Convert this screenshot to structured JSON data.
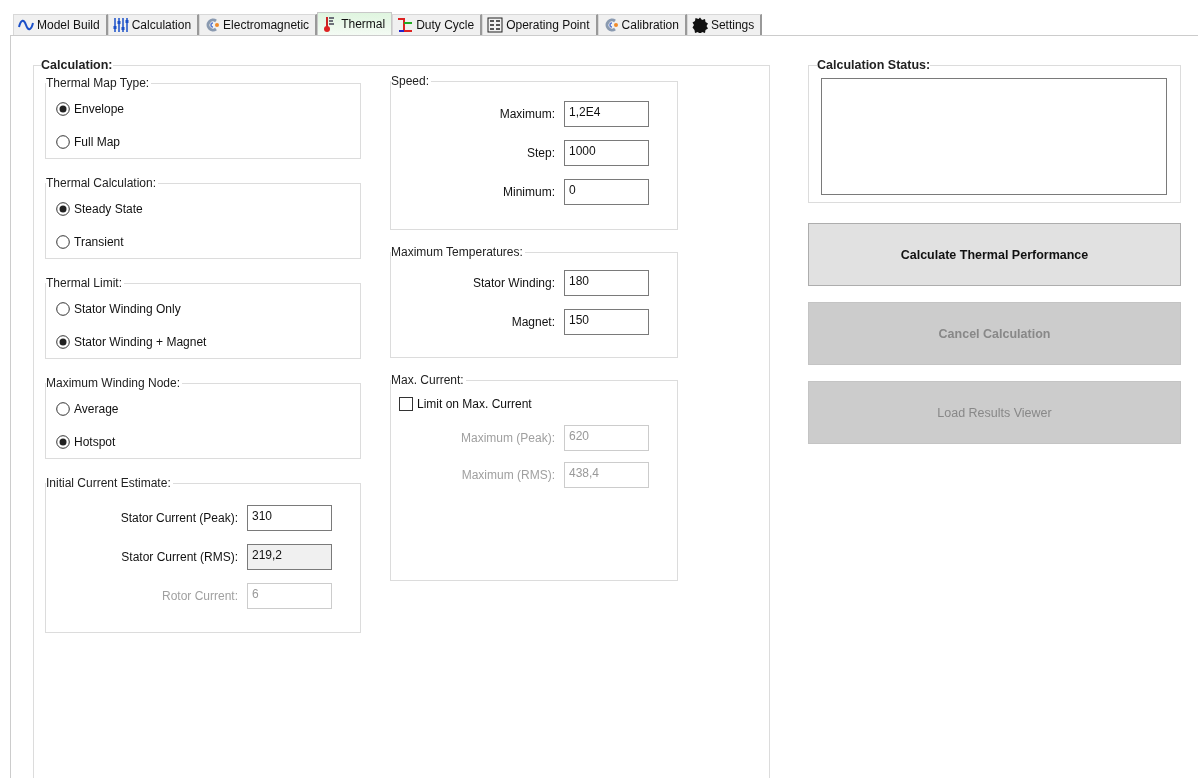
{
  "tabs": [
    {
      "label": "Model Build",
      "selected": false
    },
    {
      "label": "Calculation",
      "selected": false
    },
    {
      "label": "Electromagnetic",
      "selected": false
    },
    {
      "label": "Thermal",
      "selected": true
    },
    {
      "label": "Duty Cycle",
      "selected": false
    },
    {
      "label": "Operating Point",
      "selected": false
    },
    {
      "label": "Calibration",
      "selected": false
    },
    {
      "label": "Settings",
      "selected": false
    }
  ],
  "calculation": {
    "title": "Calculation:",
    "option_groups": [
      {
        "title": "Thermal Map Type:",
        "options": [
          {
            "label": "Envelope",
            "selected": true
          },
          {
            "label": "Full Map",
            "selected": false
          }
        ]
      },
      {
        "title": "Thermal Calculation:",
        "options": [
          {
            "label": "Steady State",
            "selected": true
          },
          {
            "label": "Transient",
            "selected": false
          }
        ]
      },
      {
        "title": "Thermal Limit:",
        "options": [
          {
            "label": "Stator Winding Only",
            "selected": false
          },
          {
            "label": "Stator Winding + Magnet",
            "selected": true
          }
        ]
      },
      {
        "title": "Maximum Winding Node:",
        "options": [
          {
            "label": "Average",
            "selected": false
          },
          {
            "label": "Hotspot",
            "selected": true
          }
        ]
      }
    ],
    "initial_current_estimate": {
      "title": "Initial Current Estimate:",
      "fields": [
        {
          "label": "Stator Current (Peak):",
          "value": "310",
          "readonly": false,
          "disabled": false
        },
        {
          "label": "Stator Current (RMS):",
          "value": "219,2",
          "readonly": true,
          "disabled": false
        },
        {
          "label": "Rotor Current:",
          "value": "6",
          "readonly": false,
          "disabled": true
        }
      ]
    },
    "speed": {
      "title": "Speed:",
      "fields": [
        {
          "label": "Maximum:",
          "value": "1,2E4",
          "readonly": false,
          "disabled": false
        },
        {
          "label": "Step:",
          "value": "1000",
          "readonly": false,
          "disabled": false
        },
        {
          "label": "Minimum:",
          "value": "0",
          "readonly": false,
          "disabled": false
        }
      ]
    },
    "maximum_temperatures": {
      "title": "Maximum Temperatures:",
      "fields": [
        {
          "label": "Stator Winding:",
          "value": "180",
          "readonly": false,
          "disabled": false
        },
        {
          "label": "Magnet:",
          "value": "150",
          "readonly": false,
          "disabled": false
        }
      ]
    },
    "max_current": {
      "title": "Max. Current:",
      "checkbox": {
        "label": "Limit on Max. Current",
        "checked": false
      },
      "fields": [
        {
          "label": "Maximum (Peak):",
          "value": "620",
          "readonly": false,
          "disabled": true
        },
        {
          "label": "Maximum (RMS):",
          "value": "438,4",
          "readonly": false,
          "disabled": true
        }
      ]
    }
  },
  "calculation_status": {
    "title": "Calculation Status:"
  },
  "buttons": [
    {
      "label": "Calculate Thermal Performance",
      "disabled": false,
      "bold": true
    },
    {
      "label": "Cancel Calculation",
      "disabled": true,
      "bold": true
    },
    {
      "label": "Load Results Viewer",
      "disabled": true,
      "bold": false
    }
  ]
}
